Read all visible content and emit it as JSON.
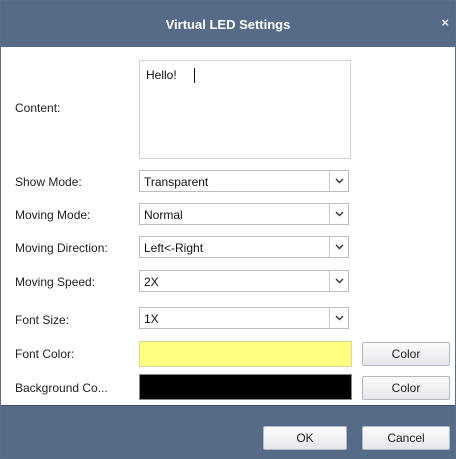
{
  "window": {
    "title": "Virtual LED Settings",
    "close_glyph": "×"
  },
  "form": {
    "content_label": "Content:",
    "content_value": "Hello!",
    "show_mode_label": "Show Mode:",
    "show_mode_value": "Transparent",
    "moving_mode_label": "Moving Mode:",
    "moving_mode_value": "Normal",
    "moving_direction_label": "Moving Direction:",
    "moving_direction_value": "Left<-Right",
    "moving_speed_label": "Moving Speed:",
    "moving_speed_value": "2X",
    "font_size_label": "Font Size:",
    "font_size_value": "1X",
    "font_color_label": "Font Color:",
    "font_color_value": "#ffff80",
    "font_color_button": "Color",
    "background_color_label": "Background Co...",
    "background_color_value": "#000000",
    "background_color_button": "Color"
  },
  "footer": {
    "ok_label": "OK",
    "cancel_label": "Cancel"
  },
  "colors": {
    "titlebar": "#566b87",
    "footer": "#566b87"
  }
}
